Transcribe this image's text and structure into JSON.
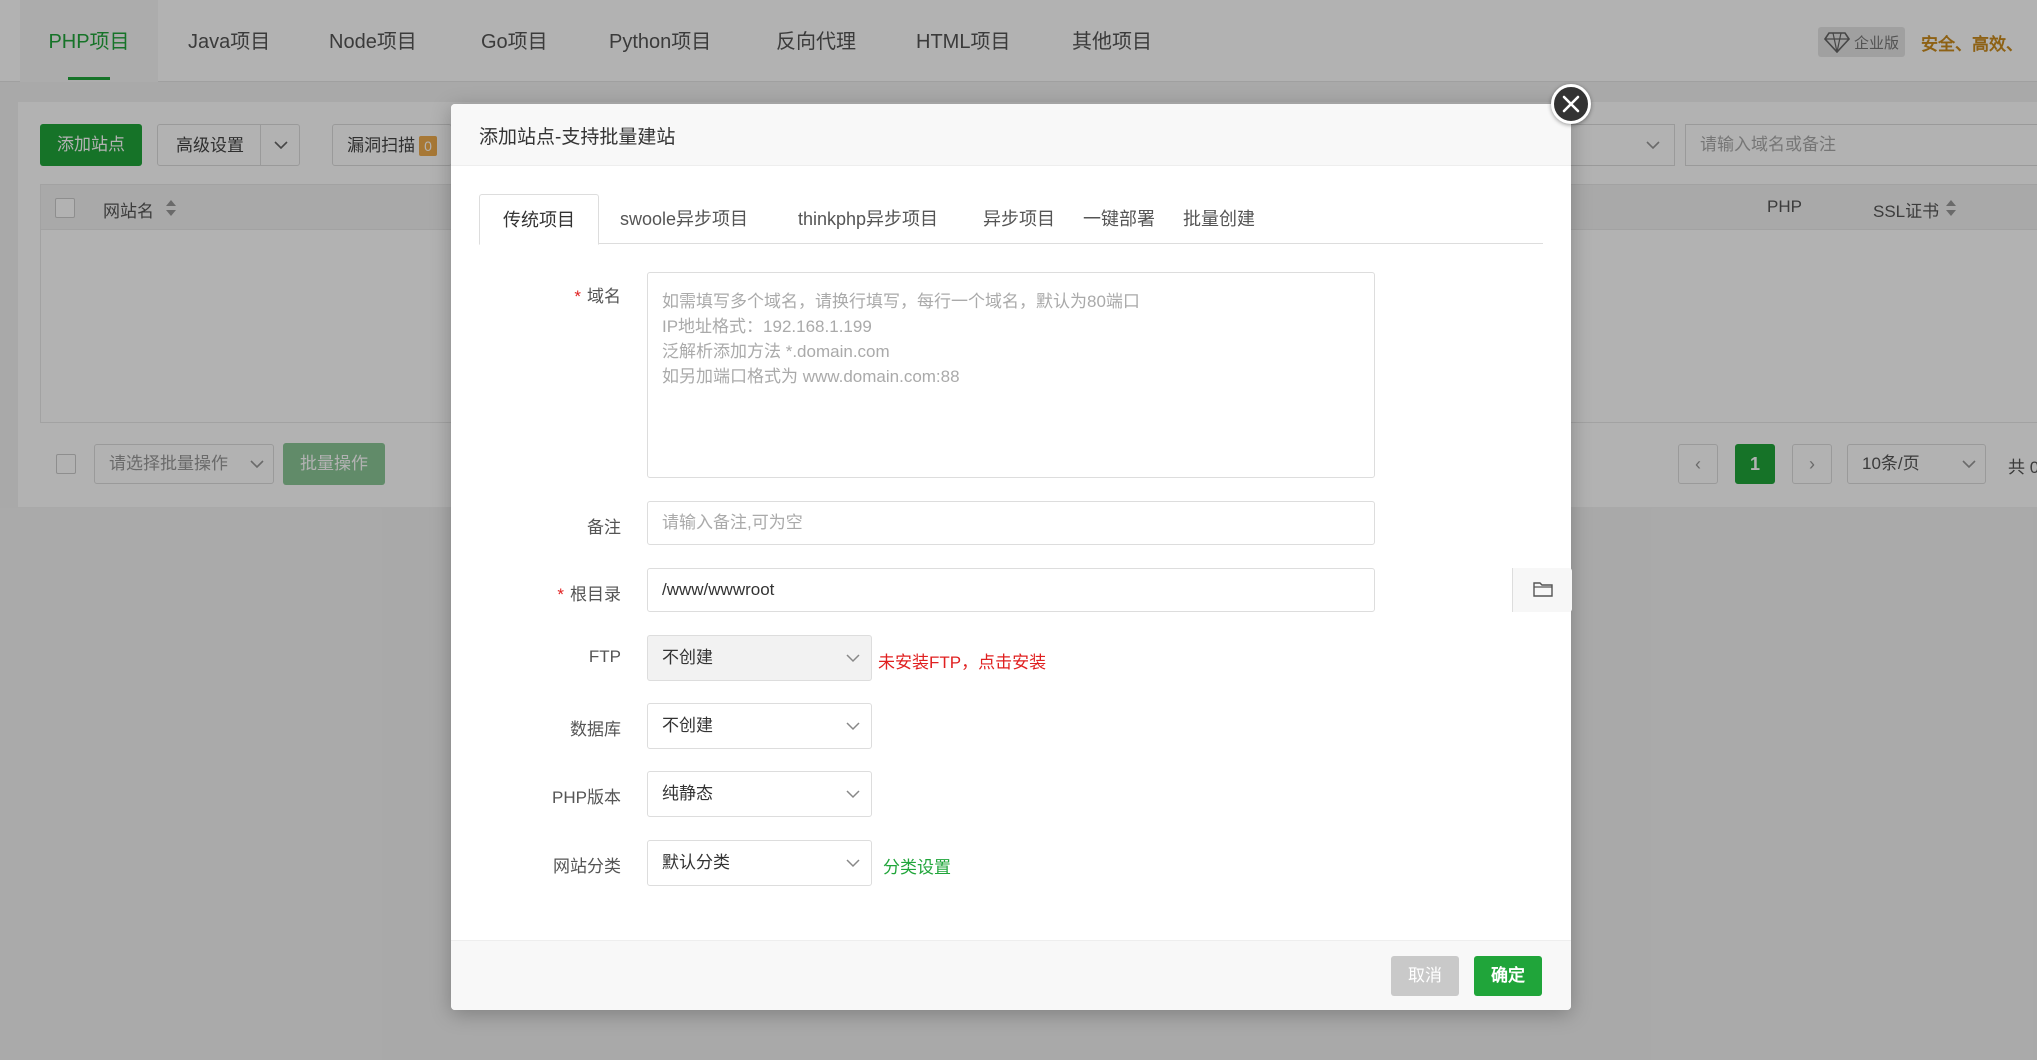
{
  "topnav": {
    "tabs": [
      "PHP项目",
      "Java项目",
      "Node项目",
      "Go项目",
      "Python项目",
      "反向代理",
      "HTML项目",
      "其他项目"
    ],
    "enterprise_label": "企业版",
    "slogan": "安全、高效、"
  },
  "toolbar": {
    "add_site": "添加站点",
    "advanced": "高级设置",
    "vuln_scan": "漏洞扫描",
    "vuln_count": "0",
    "search_placeholder": "请输入域名或备注"
  },
  "table": {
    "col_name": "网站名",
    "col_php": "PHP",
    "col_ssl": "SSL证书"
  },
  "bottom": {
    "batch_select_placeholder": "请选择批量操作",
    "batch_button": "批量操作",
    "page_current": "1",
    "page_size": "10条/页",
    "total_prefix": "共 0"
  },
  "dialog": {
    "title": "添加站点-支持批量建站",
    "tabs": [
      "传统项目",
      "swoole异步项目",
      "thinkphp异步项目",
      "异步项目",
      "一键部署",
      "批量创建"
    ],
    "domain": {
      "label": "域名",
      "placeholder_lines": [
        "如需填写多个域名，请换行填写，每行一个域名，默认为80端口",
        "IP地址格式：192.168.1.199",
        "泛解析添加方法 *.domain.com",
        "如另加端口格式为 www.domain.com:88"
      ]
    },
    "remark": {
      "label": "备注",
      "placeholder": "请输入备注,可为空"
    },
    "root": {
      "label": "根目录",
      "value": "/www/wwwroot"
    },
    "ftp": {
      "label": "FTP",
      "value": "不创建",
      "hint": "未安装FTP，点击安装"
    },
    "database": {
      "label": "数据库",
      "value": "不创建"
    },
    "php": {
      "label": "PHP版本",
      "value": "纯静态"
    },
    "category": {
      "label": "网站分类",
      "value": "默认分类",
      "link": "分类设置"
    },
    "cancel": "取消",
    "confirm": "确定"
  },
  "colors": {
    "primary": "#20a53a",
    "danger": "#e02020",
    "warning": "#cb8b1d"
  }
}
